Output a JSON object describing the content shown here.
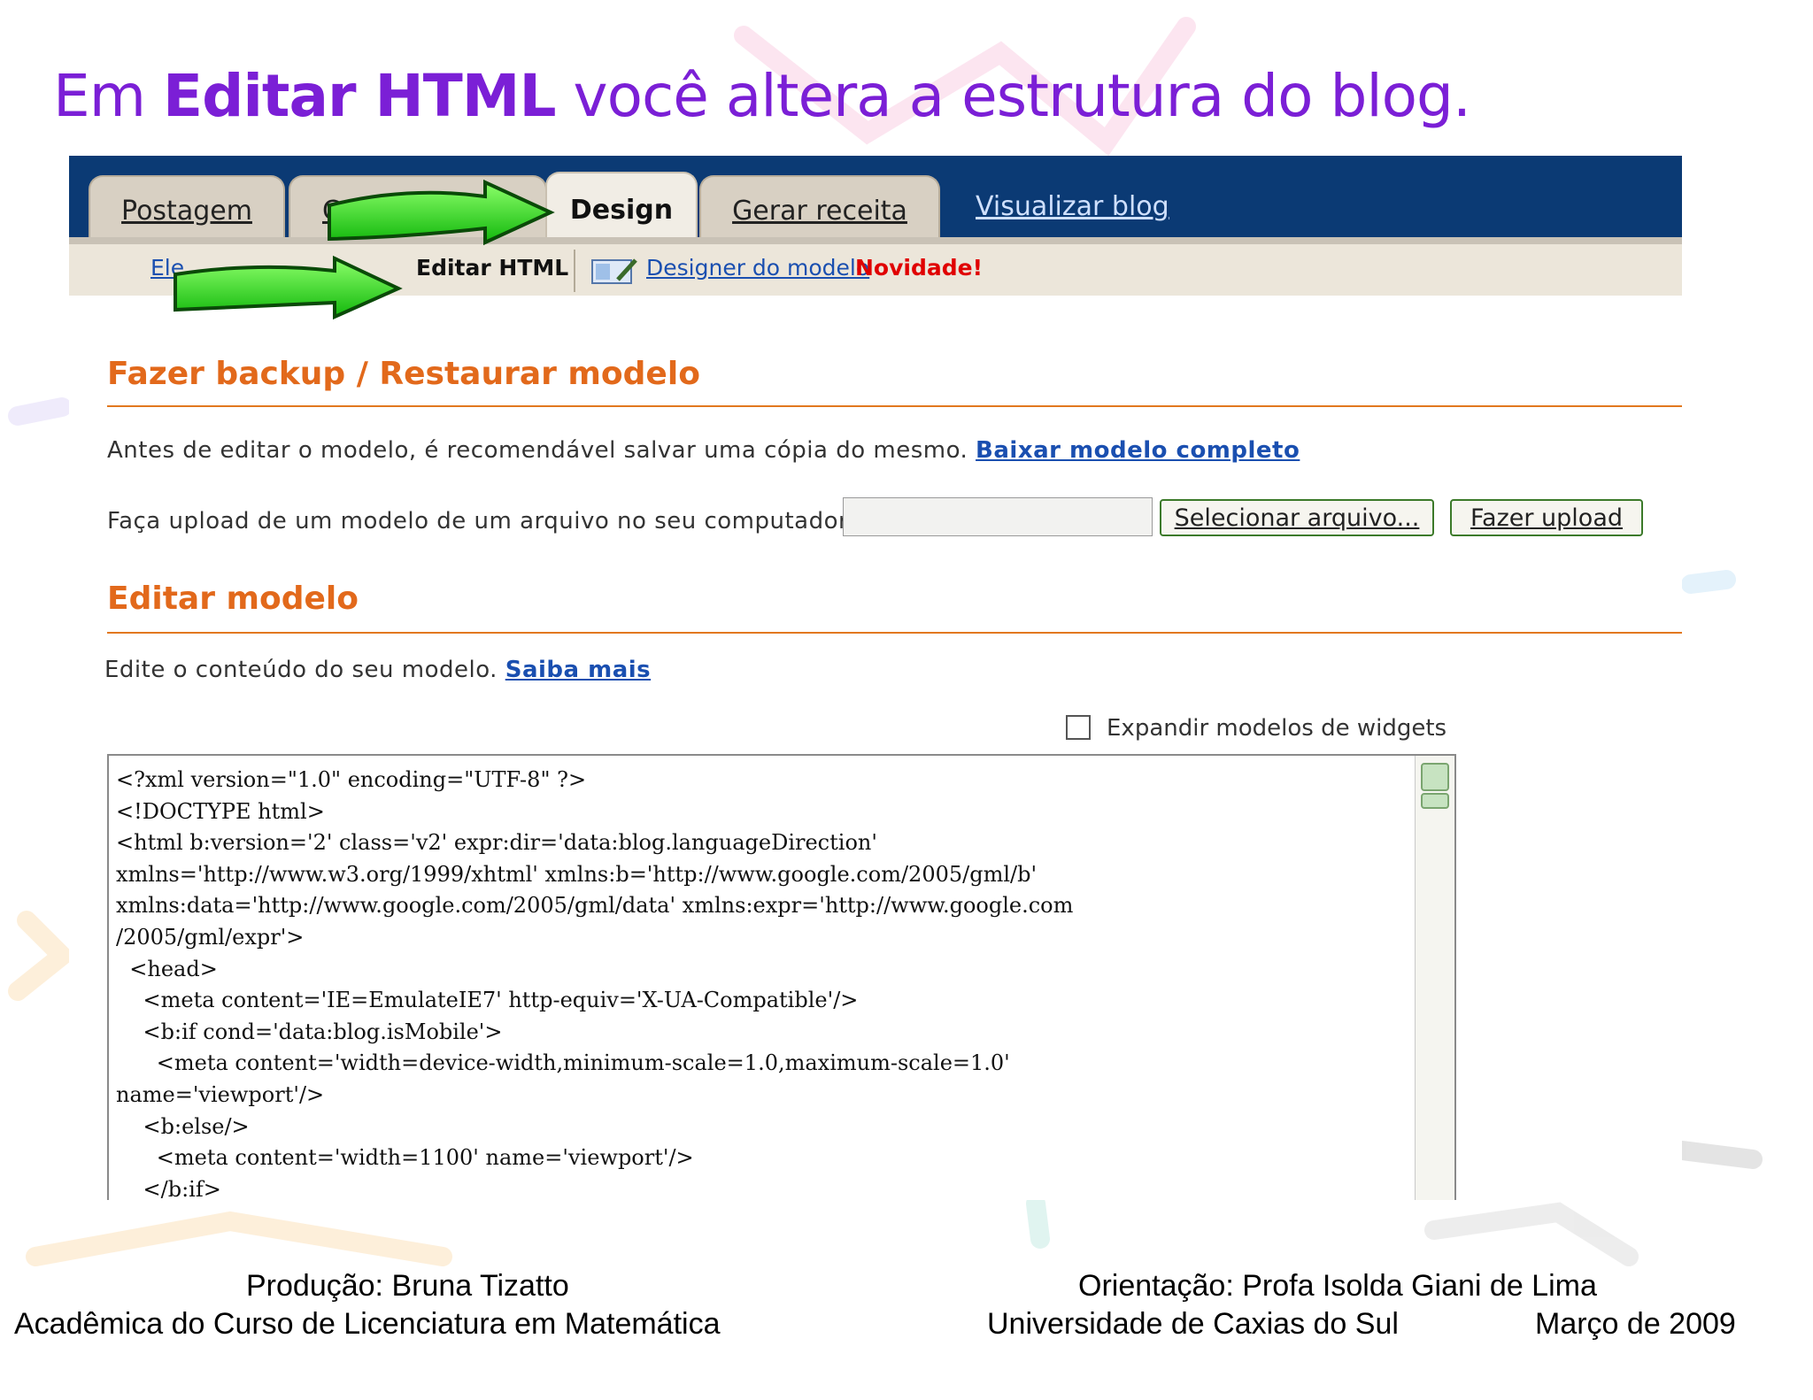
{
  "slide": {
    "title_pre": "Em ",
    "title_bold": "Editar HTML",
    "title_post": " você altera a estrutura do blog."
  },
  "tabs": {
    "postagem": "Postagem",
    "hidden": "C",
    "design": "Design",
    "gerar_receita": "Gerar receita",
    "visualizar_blog": "Visualizar blog"
  },
  "subnav": {
    "elementos_partial": "Ele",
    "editar_html": "Editar HTML",
    "designer": "Designer do modelo",
    "novidade": "Novidade!"
  },
  "backup": {
    "title": "Fazer backup / Restaurar modelo",
    "text": "Antes de editar o modelo, é recomendável salvar uma cópia do mesmo. ",
    "download_link": "Baixar modelo completo",
    "upload_text": "Faça upload de um modelo de um arquivo no seu computador:",
    "select_button": "Selecionar arquivo...",
    "upload_button": "Fazer upload"
  },
  "edit": {
    "title": "Editar modelo",
    "text": "Edite o conteúdo do seu modelo. ",
    "learn_more": "Saiba mais",
    "expand_label": "Expandir modelos de widgets",
    "code": "<?xml version=\"1.0\" encoding=\"UTF-8\" ?>\n<!DOCTYPE html>\n<html b:version='2' class='v2' expr:dir='data:blog.languageDirection'\nxmlns='http://www.w3.org/1999/xhtml' xmlns:b='http://www.google.com/2005/gml/b'\nxmlns:data='http://www.google.com/2005/gml/data' xmlns:expr='http://www.google.com\n/2005/gml/expr'>\n  <head>\n    <meta content='IE=EmulateIE7' http-equiv='X-UA-Compatible'/>\n    <b:if cond='data:blog.isMobile'>\n      <meta content='width=device-width,minimum-scale=1.0,maximum-scale=1.0'\nname='viewport'/>\n    <b:else/>\n      <meta content='width=1100' name='viewport'/>\n    </b:if>"
  },
  "footer": {
    "production": "Produção: Bruna Tizatto",
    "academic": "Acadêmica do Curso de Licenciatura em Matemática",
    "orientation": "Orientação: Profa Isolda Giani de Lima",
    "university": "Universidade de Caxias do Sul",
    "date": "Março de 2009"
  },
  "colors": {
    "title": "#7b1fd6",
    "section": "#e2691b",
    "topbar": "#0b3a74",
    "arrow": "#2fd61f"
  }
}
